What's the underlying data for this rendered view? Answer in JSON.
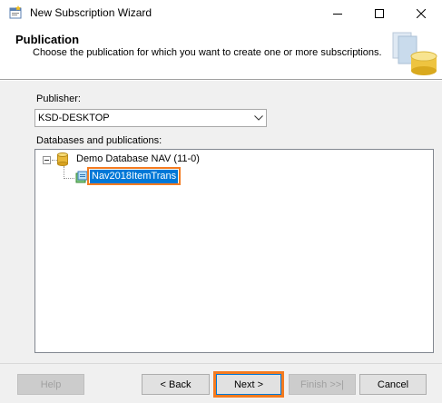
{
  "window": {
    "title": "New Subscription Wizard",
    "icon": "wizard-app-icon"
  },
  "header": {
    "title": "Publication",
    "subtitle": "Choose the publication for which you want to create one or more subscriptions.",
    "graphic": "database-wizard-graphic"
  },
  "publisher": {
    "label": "Publisher:",
    "value": "KSD-DESKTOP"
  },
  "tree": {
    "label": "Databases and publications:",
    "database": {
      "label": "Demo Database NAV (11-0)",
      "expanded": true
    },
    "publication": {
      "label": "Nav2018ItemTrans",
      "selected": true
    }
  },
  "buttons": {
    "help": "Help",
    "back": "< Back",
    "next": "Next >",
    "finish": "Finish >>|",
    "cancel": "Cancel"
  },
  "colors": {
    "highlight": "#f47b20",
    "selection": "#0078d7"
  }
}
